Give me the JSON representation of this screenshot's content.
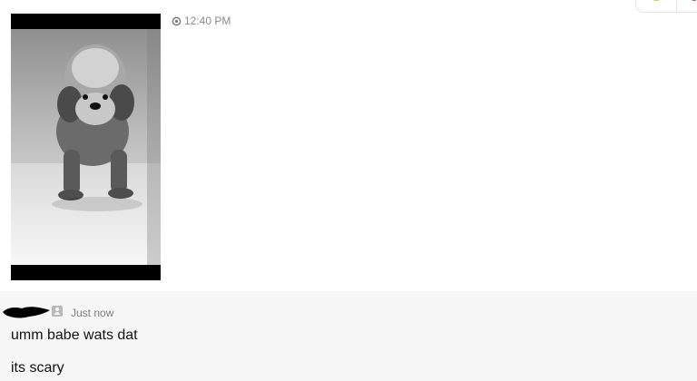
{
  "message_1": {
    "timestamp": "12:40 PM",
    "seen_icon": "eye-icon",
    "media_icon": "photo"
  },
  "message_2": {
    "time_ago": "Just now",
    "user_icon": "user-icon",
    "lines": [
      "umm babe wats dat",
      "its scary"
    ]
  },
  "colors": {
    "background": "#ffffff",
    "second_message_bg": "#f6f6f6",
    "muted_text": "#8a8a8a"
  }
}
